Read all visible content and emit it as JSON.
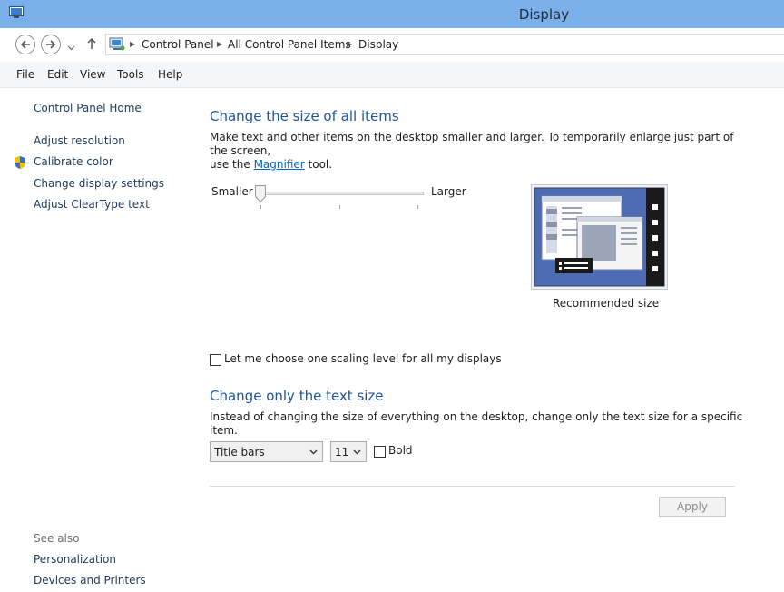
{
  "window": {
    "title": "Display"
  },
  "address": {
    "crumbs": [
      "Control Panel",
      "All Control Panel Items",
      "Display"
    ]
  },
  "menu": {
    "items": [
      "File",
      "Edit",
      "View",
      "Tools",
      "Help"
    ]
  },
  "sidebar": {
    "home": "Control Panel Home",
    "links": [
      "Adjust resolution",
      "Calibrate color",
      "Change display settings",
      "Adjust ClearType text"
    ],
    "see_also_label": "See also",
    "see_also": [
      "Personalization",
      "Devices and Printers"
    ]
  },
  "size_section": {
    "heading": "Change the size of all items",
    "desc_line1": "Make text and other items on the desktop smaller and larger. To temporarily enlarge just part of the screen,",
    "desc_line2_pre": "use the ",
    "desc_link": "Magnifier",
    "desc_line2_post": " tool.",
    "slider_min_label": "Smaller",
    "slider_max_label": "Larger",
    "slider_level": 0,
    "preview_caption": "Recommended size",
    "scaling_checkbox_label": "Let me choose one scaling level for all my displays",
    "scaling_checked": false
  },
  "text_section": {
    "heading": "Change only the text size",
    "desc": "Instead of changing the size of everything on the desktop, change only the text size for a specific item.",
    "item_select": "Title bars",
    "size_select": "11",
    "bold_label": "Bold",
    "bold_checked": false
  },
  "apply_label": "Apply",
  "colors": {
    "titlebar": "#7aafe9",
    "heading": "#1e5597",
    "link": "#0066cc"
  }
}
